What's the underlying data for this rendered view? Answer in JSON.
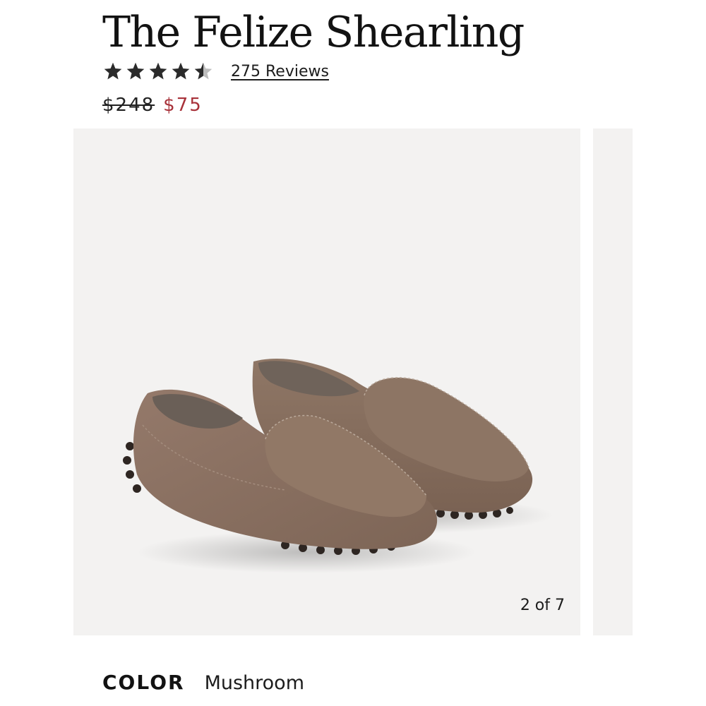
{
  "product": {
    "title": "The Felize Shearling",
    "rating": 4.5,
    "rating_max": 5,
    "reviews_label": "275 Reviews",
    "price_original": "$248",
    "price_sale": "$75"
  },
  "colors": {
    "star": "#2b2b2b",
    "star_empty": "#bdbdbd",
    "sale": "#a8323a",
    "gallery_bg": "#f3f2f1",
    "suede": "#8a7262"
  },
  "gallery": {
    "counter": "2 of 7"
  },
  "options": {
    "color_label": "COLOR",
    "color_value": "Mushroom"
  }
}
